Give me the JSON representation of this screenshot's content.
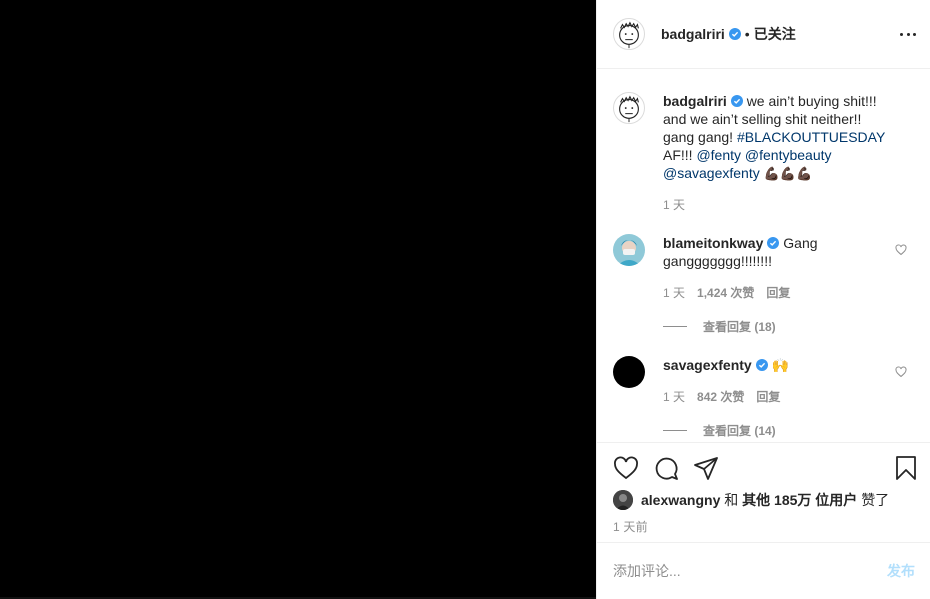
{
  "header": {
    "username": "badgalriri",
    "separator": "•",
    "follow_status": "已关注"
  },
  "caption": {
    "username": "badgalriri",
    "text_1": "we ain’t buying shit!!! and we ain’t selling shit neither!! gang gang!",
    "hashtag": "#BLACKOUTTUESDAY",
    "text_2": "AF!!!",
    "mention_1": "@fenty",
    "mention_2": "@fentybeauty",
    "mention_3": "@savagexfenty",
    "emoji": "💪🏿💪🏿💪🏿",
    "time": "1 天"
  },
  "comments": [
    {
      "username": "blameitonkway",
      "text": "Gang ganggggggg!!!!!!!!",
      "time": "1 天",
      "likes": "1,424 次赞",
      "reply": "回复",
      "view_replies": "查看回复 (18)"
    },
    {
      "username": "savagexfenty",
      "text": "🙌",
      "time": "1 天",
      "likes": "842 次赞",
      "reply": "回复",
      "view_replies": "查看回复 (14)"
    }
  ],
  "likes_line": {
    "user": "alexwangny",
    "and": "和",
    "others": "其他 185万 位用户",
    "suffix": "赞了"
  },
  "post_time": "1 天前",
  "comment_input": {
    "placeholder": "添加评论...",
    "post_label": "发布"
  },
  "colors": {
    "verified": "#3897f0",
    "link": "#00376b",
    "muted": "#8e8e8e",
    "post_button": "#b2dffc"
  }
}
